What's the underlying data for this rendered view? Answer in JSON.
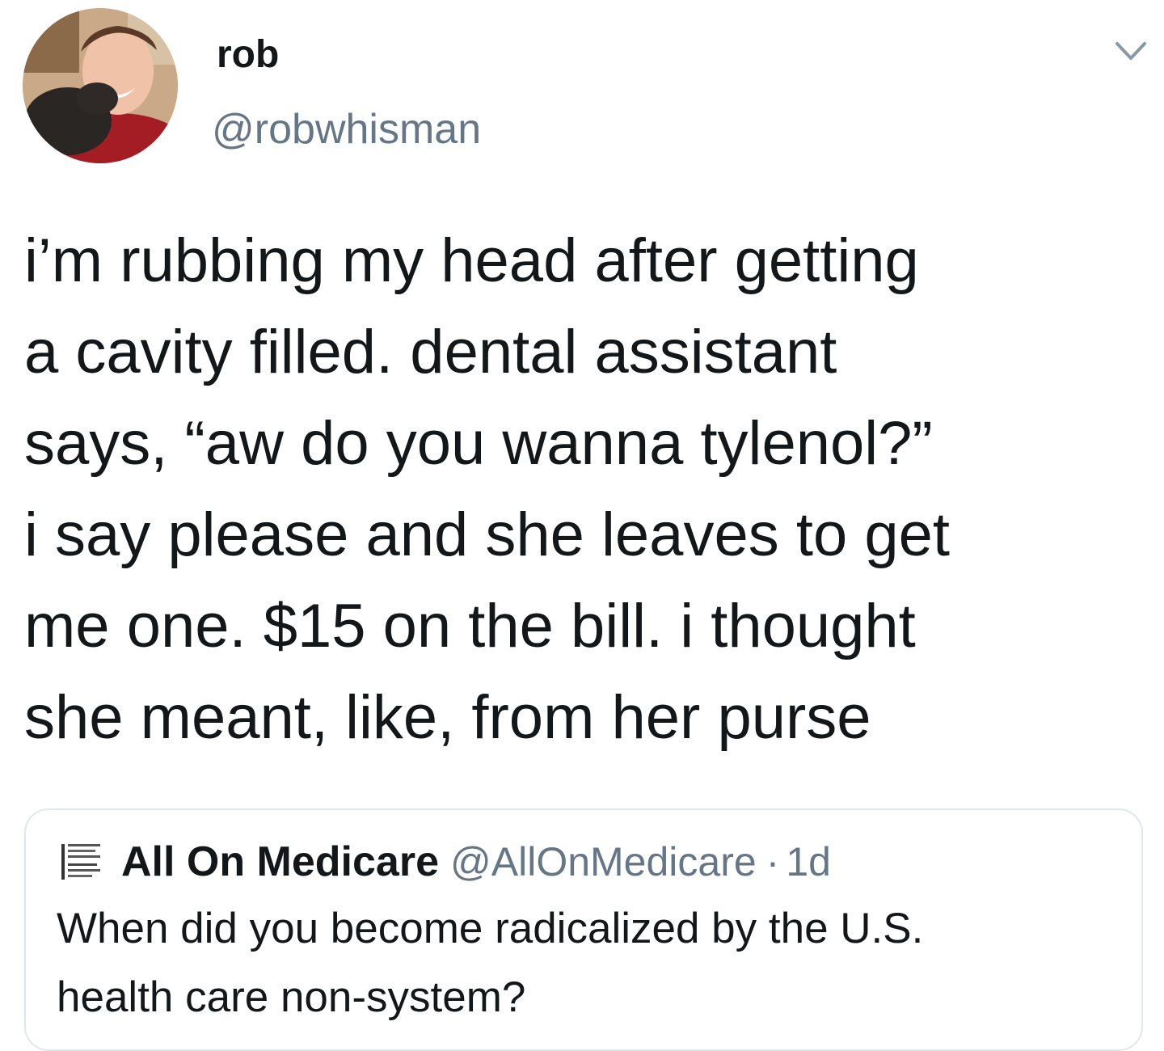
{
  "tweet": {
    "author": {
      "display_name": "rob",
      "handle": "@robwhisman",
      "avatar_icon": "profile-photo"
    },
    "menu_icon": "chevron-down-icon",
    "text_lines": [
      "i’m rubbing my head after getting",
      "a cavity filled. dental assistant",
      "says, “aw do you wanna tylenol?”",
      "i say please and she leaves to get",
      "me one. $15 on the bill. i thought",
      "she meant, like, from her purse"
    ]
  },
  "quoted_tweet": {
    "logo_icon": "medicare-logo-icon",
    "display_name": "All On Medicare",
    "handle": "@AllOnMedicare",
    "separator": "·",
    "time": "1d",
    "text_lines": [
      "When did you become radicalized by the U.S.",
      "health care non-system?"
    ]
  },
  "colors": {
    "primary_text": "#14171a",
    "secondary_text": "#657786",
    "border": "#e1e8ed",
    "background": "#ffffff"
  }
}
